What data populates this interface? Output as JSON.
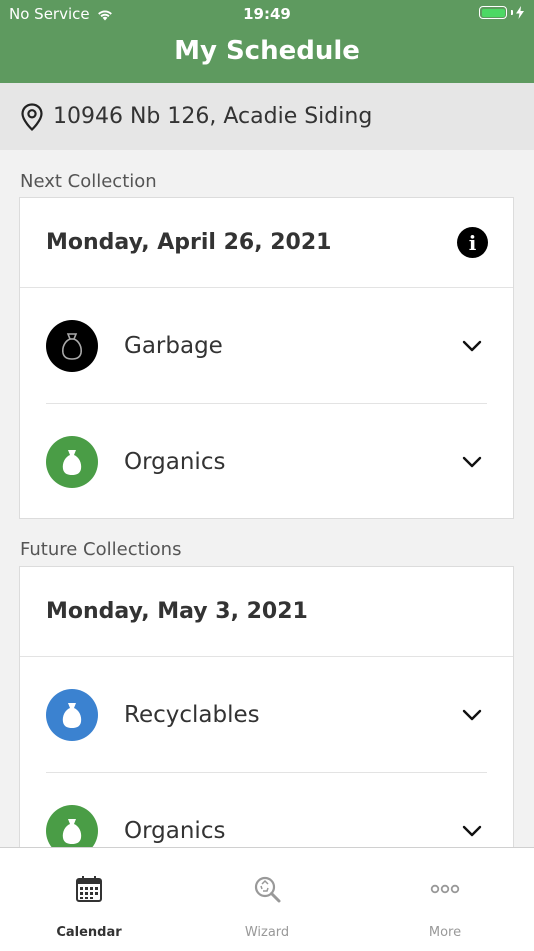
{
  "status_bar": {
    "carrier": "No Service",
    "time": "19:49"
  },
  "header": {
    "title": "My Schedule"
  },
  "address": {
    "text": "10946 Nb 126, Acadie Siding"
  },
  "next_collection": {
    "section_label": "Next Collection",
    "date": "Monday, April 26, 2021",
    "items": [
      {
        "label": "Garbage",
        "bag_color": "#000000",
        "icon": "garbage-bag-icon"
      },
      {
        "label": "Organics",
        "bag_color": "#4a9d46",
        "icon": "organics-bag-icon"
      }
    ]
  },
  "future_collections": {
    "section_label": "Future Collections",
    "date": "Monday, May 3, 2021",
    "items": [
      {
        "label": "Recyclables",
        "bag_color": "#3b82d0",
        "icon": "recyclables-bag-icon"
      },
      {
        "label": "Organics",
        "bag_color": "#4a9d46",
        "icon": "organics-bag-icon"
      }
    ]
  },
  "tabs": [
    {
      "label": "Calendar",
      "icon": "calendar-icon",
      "active": true
    },
    {
      "label": "Wizard",
      "icon": "wizard-search-icon",
      "active": false
    },
    {
      "label": "More",
      "icon": "more-dots-icon",
      "active": false
    }
  ],
  "colors": {
    "header_green": "#5e9a5f",
    "battery": "#4cd964"
  }
}
